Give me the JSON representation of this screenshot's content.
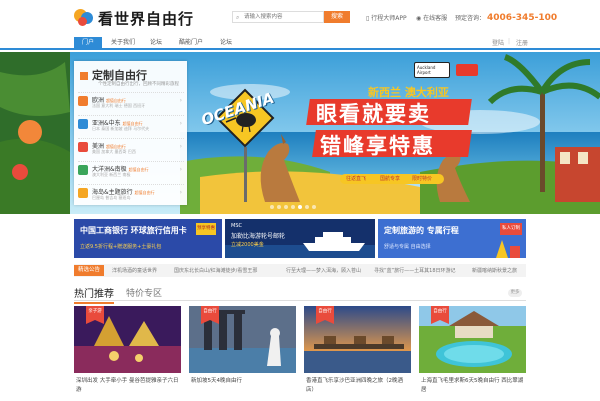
{
  "header": {
    "logo_text": "看世界自由行",
    "search_placeholder": "请输入搜索内容",
    "search_button": "搜索",
    "app_label": "行程大师APP",
    "service_label": "在线客服",
    "hotline_label": "预定咨询：",
    "hotline_number": "4006-345-100"
  },
  "nav": {
    "items": [
      "门户",
      "关于我们",
      "论坛",
      "酷能门户",
      "论坛"
    ],
    "active_index": 0,
    "right": [
      "登陆",
      "|",
      "注册"
    ]
  },
  "categories": {
    "title": "定制自由行",
    "subtitle": "个性定制自由行出行，回顾不同精彩旅程",
    "items": [
      {
        "name": "欧洲",
        "badge": "超值自由行",
        "desc": "法国 意大利 瑞士 德国 西班牙"
      },
      {
        "name": "亚洲&中东",
        "badge": "超值自由行",
        "desc": "日本 泰国 新加坡 迪拜 马尔代夫"
      },
      {
        "name": "美洲",
        "badge": "超值自由行",
        "desc": "美国 加拿大 墨西哥 巴西"
      },
      {
        "name": "大洋洲&南极",
        "badge": "超值自由行",
        "desc": "澳大利亚 新西兰 南极"
      },
      {
        "name": "海岛&主题旅行",
        "badge": "超值自由行",
        "desc": "巴厘岛 普吉岛 塞班岛"
      }
    ]
  },
  "banner": {
    "oceania": "OCEANIA",
    "airline": "Auckland Airport",
    "headline_top": "新西兰 澳大利亚",
    "headline_1": "眼看就要卖",
    "headline_2": "错峰享特惠",
    "tags": [
      "往返直飞",
      "国航专享",
      "限时特价"
    ],
    "slides": 7,
    "active_slide": 4
  },
  "ads": [
    {
      "title": "中国工商银行  环球旅行信用卡",
      "line1": "立返9.5折行程+赠送服务+土豪礼包",
      "badge": "预享特惠"
    },
    {
      "title": "MSC",
      "line1": "加勒比海游轮号邮轮",
      "line2": "立减2000美金"
    },
    {
      "title": "定制旅游的  专属行程",
      "line1": "舒适与专属 自由选择",
      "badge": "私人订制"
    }
  ],
  "marquee": {
    "label": "精选公告",
    "items": [
      "洋机场酒的童话世界",
      "国庆东北长白山/红海滩徒步/看雪王邪",
      "行至大理——梦入洱海，顾入苍山",
      "寻找“蓝”旅行——土耳其18日环游记",
      "新疆喀纳斯秋景之旅"
    ]
  },
  "section": {
    "active_tab": "热门推荐",
    "tab2": "特价专区",
    "more": "更多"
  },
  "cards": [
    {
      "tag": "亲子游",
      "caption": "深圳出发 大手牵小手 曼谷芭提雅亲子六日游"
    },
    {
      "tag": "自由行",
      "caption": "新加坡5天4晚自由行"
    },
    {
      "tag": "自由行",
      "caption": "香港直飞乐享沙巴亚洲四晚之旅（2晚酒店）"
    },
    {
      "tag": "自由行",
      "caption": "上海直飞毛里求斯6天5晚自由行 西比翠湖居"
    }
  ],
  "colors": {
    "brand_orange": "#f07c2d",
    "brand_blue": "#2e8bd6",
    "banner_red": "#e83a2c"
  }
}
